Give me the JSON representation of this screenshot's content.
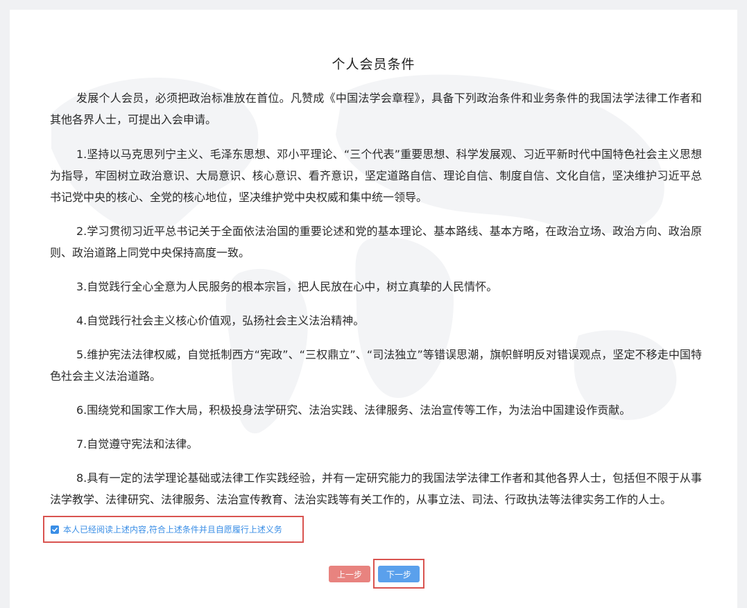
{
  "page": {
    "title": "个人会员条件",
    "paragraphs": [
      "发展个人会员，必须把政治标准放在首位。凡赞成《中国法学会章程》，具备下列政治条件和业务条件的我国法学法律工作者和其他各界人士，可提出入会申请。",
      "1.坚持以马克思列宁主义、毛泽东思想、邓小平理论、“三个代表”重要思想、科学发展观、习近平新时代中国特色社会主义思想为指导，牢固树立政治意识、大局意识、核心意识、看齐意识，坚定道路自信、理论自信、制度自信、文化自信，坚决维护习近平总书记党中央的核心、全党的核心地位，坚决维护党中央权威和集中统一领导。",
      "2.学习贯彻习近平总书记关于全面依法治国的重要论述和党的基本理论、基本路线、基本方略，在政治立场、政治方向、政治原则、政治道路上同党中央保持高度一致。",
      "3.自觉践行全心全意为人民服务的根本宗旨，把人民放在心中，树立真挚的人民情怀。",
      "4.自觉践行社会主义核心价值观，弘扬社会主义法治精神。",
      "5.维护宪法法律权威，自觉抵制西方“宪政”、“三权鼎立”、“司法独立”等错误思潮，旗帜鲜明反对错误观点，坚定不移走中国特色社会主义法治道路。",
      "6.围绕党和国家工作大局，积极投身法学研究、法治实践、法律服务、法治宣传等工作，为法治中国建设作贡献。",
      "7.自觉遵守宪法和法律。",
      "8.具有一定的法学理论基础或法律工作实践经验，并有一定研究能力的我国法学法律工作者和其他各界人士，包括但不限于从事法学教学、法律研究、法律服务、法治宣传教育、法治实践等有关工作的，从事立法、司法、行政执法等法律实务工作的人士。"
    ],
    "agreement": {
      "label": "本人已经阅读上述内容,符合上述条件并且自愿履行上述义务",
      "checked": true
    },
    "buttons": {
      "prev_label": "上一步",
      "next_label": "下一步"
    }
  },
  "colors": {
    "accent": "#3a8ee6",
    "prev_button": "#e8837f",
    "next_button": "#5aa0ec",
    "highlight_border": "#d9534f"
  },
  "icons": {
    "checkbox": "check-icon"
  }
}
